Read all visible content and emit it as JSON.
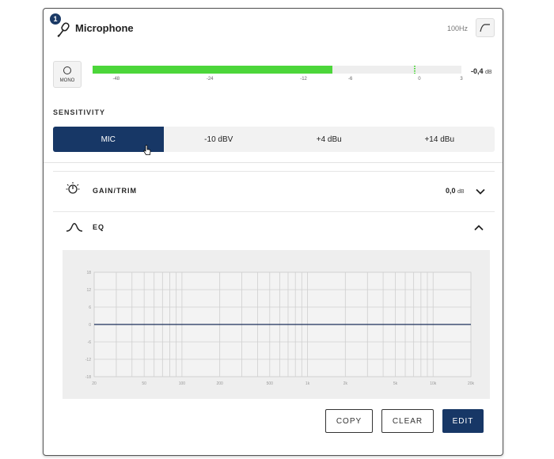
{
  "header": {
    "channel_number": "1",
    "title": "Microphone",
    "hpf_frequency": "100Hz",
    "icons": {
      "mic": "microphone-icon",
      "hpf": "high-pass-filter-icon"
    }
  },
  "meter": {
    "mono_label": "MONO",
    "level_fraction": 0.651,
    "peak_fraction": 0.871,
    "ticks": [
      "-48",
      "-24",
      "-12",
      "-6",
      "0",
      "3"
    ],
    "value": "-0,4",
    "unit": "dB",
    "color": "#4cd63a"
  },
  "sensitivity": {
    "label": "SENSITIVITY",
    "options": [
      "MIC",
      "-10 dBV",
      "+4 dBu",
      "+14 dBu"
    ],
    "selected": "MIC",
    "active_color": "#173766"
  },
  "gain_trim": {
    "title": "GAIN/TRIM",
    "value": "0,0",
    "unit": "dB",
    "icon": "gain-knob-icon",
    "state": "collapsed"
  },
  "eq": {
    "title": "EQ",
    "icon": "eq-curve-icon",
    "state": "expanded",
    "graph": {
      "y_ticks": [
        "18",
        "12",
        "6",
        "0",
        "-6",
        "-12",
        "-18"
      ],
      "y_values": [
        18,
        12,
        6,
        0,
        -6,
        -12,
        -18
      ],
      "x_ticks": [
        "20",
        "50",
        "100",
        "200",
        "500",
        "1k",
        "2k",
        "5k",
        "10k",
        "20k"
      ],
      "x_values": [
        20,
        50,
        100,
        200,
        500,
        1000,
        2000,
        5000,
        10000,
        20000
      ],
      "curve_db": 0,
      "curve_color": "#1b2f5a"
    }
  },
  "footer": {
    "copy_label": "COPY",
    "clear_label": "CLEAR",
    "edit_label": "EDIT"
  }
}
